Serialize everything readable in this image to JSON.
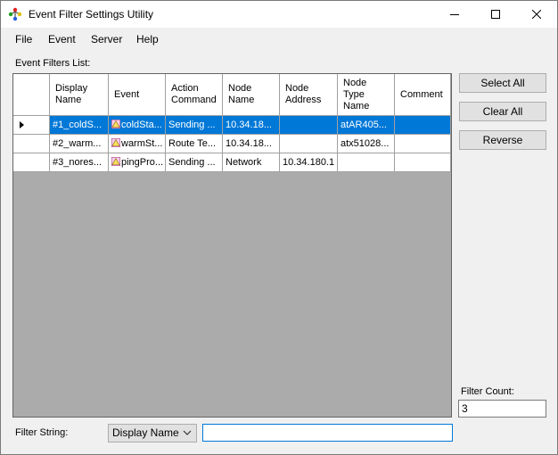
{
  "window": {
    "title": "Event Filter Settings Utility"
  },
  "menu": [
    "File",
    "Event",
    "Server",
    "Help"
  ],
  "list_label": "Event Filters List:",
  "columns": [
    "Display Name",
    "Event",
    "Action Command",
    "Node Name",
    "Node Address",
    "Node Type Name",
    "Comment"
  ],
  "rows": [
    {
      "display_name": "#1_coldS...",
      "event": "coldSta...",
      "action": "Sending ...",
      "node_name": "10.34.18...",
      "node_address": "",
      "node_type": "atAR405...",
      "comment": "",
      "selected": true
    },
    {
      "display_name": "#2_warm...",
      "event": "warmSt...",
      "action": "Route Te...",
      "node_name": "10.34.18...",
      "node_address": "",
      "node_type": "atx51028...",
      "comment": "",
      "selected": false
    },
    {
      "display_name": "#3_nores...",
      "event": "pingPro...",
      "action": "Sending ...",
      "node_name": "Network",
      "node_address": "10.34.180.1",
      "node_type": "",
      "comment": "",
      "selected": false
    }
  ],
  "buttons": {
    "select_all": "Select All",
    "clear_all": "Clear All",
    "reverse": "Reverse"
  },
  "filter_count": {
    "label": "Filter Count:",
    "value": "3"
  },
  "filter_string": {
    "label": "Filter String:",
    "field_selected": "Display Name",
    "value": ""
  },
  "colors": {
    "selection": "#0078d7",
    "grid_background": "#ababab",
    "button": "#e1e1e1"
  },
  "icons": {
    "app": "tree-colored-icon",
    "event": "alert-triangle-icon"
  }
}
